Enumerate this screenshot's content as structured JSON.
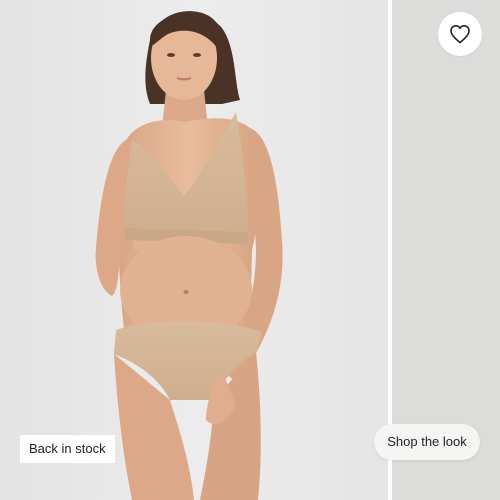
{
  "product_card": {
    "badge": "Back in stock",
    "wishlist_icon": "heart-outline-icon",
    "shop_the_look_label": "Shop the look"
  },
  "colors": {
    "main_background": "#e6e6e6",
    "next_slide_background": "#dcdcdb",
    "garment": "#d3b597",
    "skin": "#e3b596",
    "hair": "#4a3326",
    "button_background": "#ffffff",
    "text": "#222222"
  }
}
